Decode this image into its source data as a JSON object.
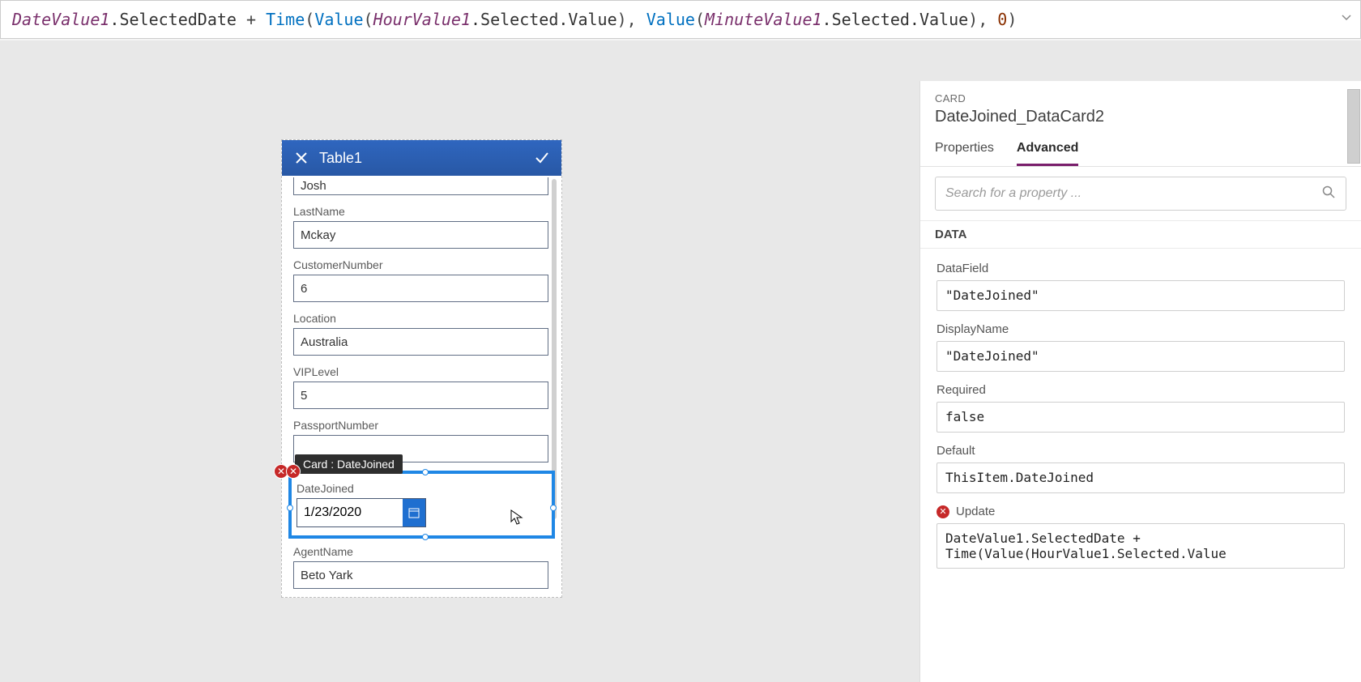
{
  "formula": {
    "tokens": [
      {
        "t": "DateValue1",
        "c": "fx-ident"
      },
      {
        "t": ".SelectedDate ",
        "c": "fx-dot"
      },
      {
        "t": "+ ",
        "c": "fx-punc"
      },
      {
        "t": "Time",
        "c": "fx-func"
      },
      {
        "t": "(",
        "c": "fx-punc"
      },
      {
        "t": "Value",
        "c": "fx-func"
      },
      {
        "t": "(",
        "c": "fx-punc"
      },
      {
        "t": "HourValue1",
        "c": "fx-ident"
      },
      {
        "t": ".Selected.Value",
        "c": "fx-dot"
      },
      {
        "t": ")",
        "c": "fx-punc"
      },
      {
        "t": ", ",
        "c": "fx-punc"
      },
      {
        "t": "Value",
        "c": "fx-func"
      },
      {
        "t": "(",
        "c": "fx-punc"
      },
      {
        "t": "MinuteValue1",
        "c": "fx-ident"
      },
      {
        "t": ".Selected.Value",
        "c": "fx-dot"
      },
      {
        "t": ")",
        "c": "fx-punc"
      },
      {
        "t": ", ",
        "c": "fx-punc"
      },
      {
        "t": "0",
        "c": "fx-num"
      },
      {
        "t": ")",
        "c": "fx-punc"
      }
    ]
  },
  "form": {
    "title": "Table1",
    "firstname_value": "Josh",
    "fields": [
      {
        "label": "LastName",
        "value": "Mckay"
      },
      {
        "label": "CustomerNumber",
        "value": "6"
      },
      {
        "label": "Location",
        "value": "Australia"
      },
      {
        "label": "VIPLevel",
        "value": "5"
      },
      {
        "label": "PassportNumber",
        "value": ""
      }
    ],
    "selected": {
      "tooltip": "Card : DateJoined",
      "label": "DateJoined",
      "value": "1/23/2020"
    },
    "after": [
      {
        "label": "AgentName",
        "value": "Beto Yark"
      }
    ]
  },
  "panel": {
    "kicker": "CARD",
    "title": "DateJoined_DataCard2",
    "tabs": {
      "properties": "Properties",
      "advanced": "Advanced"
    },
    "search_placeholder": "Search for a property ...",
    "section": "DATA",
    "props": [
      {
        "label": "DataField",
        "value": "\"DateJoined\""
      },
      {
        "label": "DisplayName",
        "value": "\"DateJoined\""
      },
      {
        "label": "Required",
        "value": "false"
      },
      {
        "label": "Default",
        "value": "ThisItem.DateJoined"
      },
      {
        "label": "Update",
        "value": "DateValue1.SelectedDate + Time(Value(HourValue1.Selected.Value",
        "error": true
      }
    ]
  }
}
